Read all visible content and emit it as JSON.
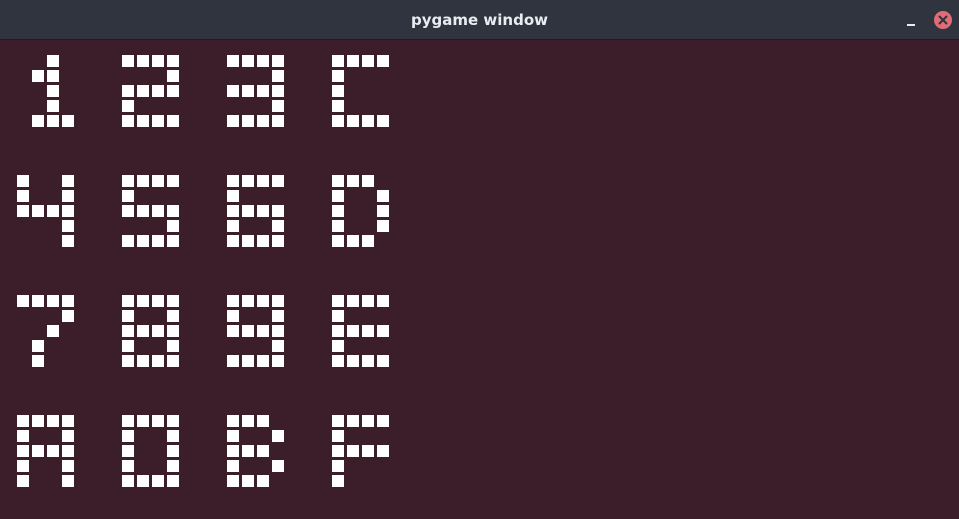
{
  "window": {
    "title": "pygame window",
    "colors": {
      "background": "#3b1e2a",
      "titlebar": "#2f343f",
      "pixel": "#ffffff",
      "close_button": "#e06c75"
    }
  },
  "keypad": {
    "rows": [
      [
        {
          "label": "1",
          "pattern": [
            "..#..",
            ".##..",
            "..#..",
            "..#..",
            ".###."
          ]
        },
        {
          "label": "2",
          "pattern": [
            "####.",
            "...#.",
            "####.",
            "#....",
            "####."
          ]
        },
        {
          "label": "3",
          "pattern": [
            "####.",
            "...#.",
            "####.",
            "...#.",
            "####."
          ]
        },
        {
          "label": "C",
          "pattern": [
            "####.",
            "#....",
            "#....",
            "#....",
            "####."
          ]
        }
      ],
      [
        {
          "label": "4",
          "pattern": [
            "#..#.",
            "#..#.",
            "####.",
            "...#.",
            "...#."
          ]
        },
        {
          "label": "5",
          "pattern": [
            "####.",
            "#....",
            "####.",
            "...#.",
            "####."
          ]
        },
        {
          "label": "6",
          "pattern": [
            "####.",
            "#....",
            "####.",
            "#..#.",
            "####."
          ]
        },
        {
          "label": "D",
          "pattern": [
            "###..",
            "#..#.",
            "#..#.",
            "#..#.",
            "###.."
          ]
        }
      ],
      [
        {
          "label": "7",
          "pattern": [
            "####.",
            "...#.",
            "..#..",
            ".#...",
            ".#..."
          ]
        },
        {
          "label": "8",
          "pattern": [
            "####.",
            "#..#.",
            "####.",
            "#..#.",
            "####."
          ]
        },
        {
          "label": "9",
          "pattern": [
            "####.",
            "#..#.",
            "####.",
            "...#.",
            "####."
          ]
        },
        {
          "label": "E",
          "pattern": [
            "####.",
            "#....",
            "####.",
            "#....",
            "####."
          ]
        }
      ],
      [
        {
          "label": "A",
          "pattern": [
            "####.",
            "#..#.",
            "####.",
            "#..#.",
            "#..#."
          ]
        },
        {
          "label": "0",
          "pattern": [
            "####.",
            "#..#.",
            "#..#.",
            "#..#.",
            "####."
          ]
        },
        {
          "label": "B",
          "pattern": [
            "###..",
            "#..#.",
            "###..",
            "#..#.",
            "###.."
          ]
        },
        {
          "label": "F",
          "pattern": [
            "####.",
            "#....",
            "####.",
            "#....",
            "#...."
          ]
        }
      ]
    ]
  }
}
